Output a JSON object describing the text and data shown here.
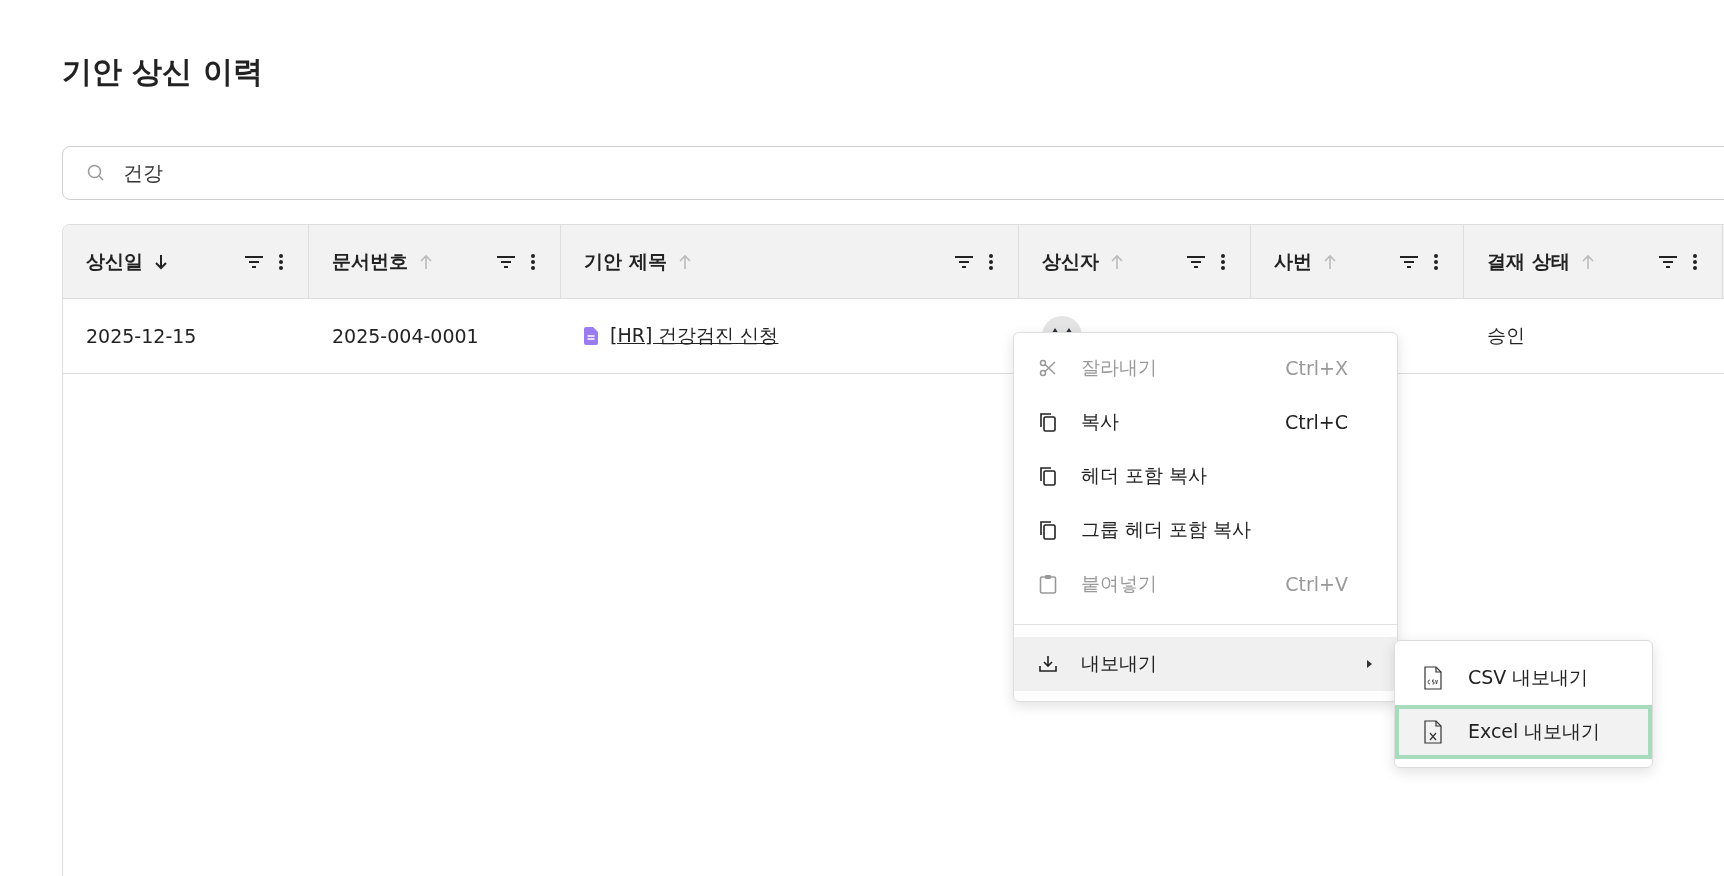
{
  "page": {
    "title": "기안 상신 이력"
  },
  "search": {
    "value": "건강"
  },
  "table": {
    "columns": [
      {
        "label": "상신일",
        "sorted": true
      },
      {
        "label": "문서번호",
        "sorted": false
      },
      {
        "label": "기안 제목",
        "sorted": false
      },
      {
        "label": "상신자",
        "sorted": false
      },
      {
        "label": "사번",
        "sorted": false
      },
      {
        "label": "결재 상태",
        "sorted": false
      }
    ],
    "rows": [
      {
        "date": "2025-12-15",
        "doc_no": "2025-004-0001",
        "title": "[HR] 건강검진 신청",
        "status": "승인"
      }
    ]
  },
  "context_menu": {
    "items": [
      {
        "kind": "action",
        "label": "잘라내기",
        "shortcut": "Ctrl+X",
        "disabled": true
      },
      {
        "kind": "action",
        "label": "복사",
        "shortcut": "Ctrl+C",
        "disabled": false
      },
      {
        "kind": "action",
        "label": "헤더 포함 복사",
        "disabled": false
      },
      {
        "kind": "action",
        "label": "그룹 헤더 포함 복사",
        "disabled": false
      },
      {
        "kind": "action",
        "label": "붙여넣기",
        "shortcut": "Ctrl+V",
        "disabled": true
      },
      {
        "kind": "separator"
      },
      {
        "kind": "submenu",
        "label": "내보내기",
        "expanded": true,
        "children": [
          {
            "label": "CSV 내보내기",
            "selected": false
          },
          {
            "label": "Excel 내보내기",
            "selected": true
          }
        ]
      }
    ]
  }
}
